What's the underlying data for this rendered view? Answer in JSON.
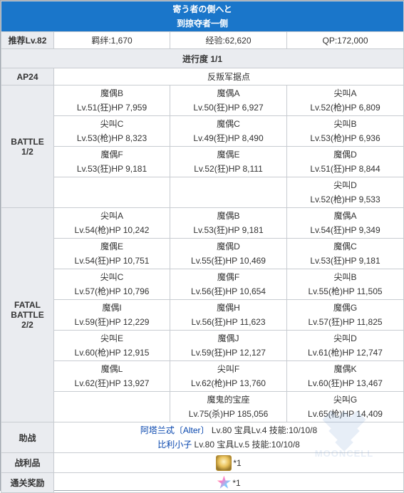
{
  "header": {
    "title_line1": "寄う者の側へと",
    "title_line2": "到掠夺者一侧"
  },
  "summary": {
    "recommend_label": "推荐Lv.82",
    "bond": "羁绊:1,670",
    "exp": "经验:62,620",
    "qp": "QP:172,000"
  },
  "progress": "进行度 1/1",
  "ap": {
    "label": "AP24",
    "location": "反叛军据点"
  },
  "battle1": {
    "label_line1": "BATTLE",
    "label_line2": "1/2",
    "rows": [
      [
        {
          "name": "魔偶B",
          "stat": "Lv.51(狂)HP 7,959"
        },
        {
          "name": "魔偶A",
          "stat": "Lv.50(狂)HP 6,927"
        },
        {
          "name": "尖叫A",
          "stat": "Lv.52(枪)HP 6,809"
        }
      ],
      [
        {
          "name": "尖叫C",
          "stat": "Lv.53(枪)HP 8,323"
        },
        {
          "name": "魔偶C",
          "stat": "Lv.49(狂)HP 8,490"
        },
        {
          "name": "尖叫B",
          "stat": "Lv.53(枪)HP 6,936"
        }
      ],
      [
        {
          "name": "魔偶F",
          "stat": "Lv.53(狂)HP 9,181"
        },
        {
          "name": "魔偶E",
          "stat": "Lv.52(狂)HP 8,111"
        },
        {
          "name": "魔偶D",
          "stat": "Lv.51(狂)HP 8,844"
        }
      ],
      [
        {
          "name": "",
          "stat": ""
        },
        {
          "name": "",
          "stat": ""
        },
        {
          "name": "尖叫D",
          "stat": "Lv.52(枪)HP 9,533"
        }
      ]
    ]
  },
  "battle2": {
    "label_line1": "FATAL",
    "label_line2": "BATTLE",
    "label_line3": "2/2",
    "rows": [
      [
        {
          "name": "尖叫A",
          "stat": "Lv.54(枪)HP 10,242"
        },
        {
          "name": "魔偶B",
          "stat": "Lv.53(狂)HP 9,181"
        },
        {
          "name": "魔偶A",
          "stat": "Lv.54(狂)HP 9,349"
        }
      ],
      [
        {
          "name": "魔偶E",
          "stat": "Lv.54(狂)HP 10,751"
        },
        {
          "name": "魔偶D",
          "stat": "Lv.55(狂)HP 10,469"
        },
        {
          "name": "魔偶C",
          "stat": "Lv.53(狂)HP 9,181"
        }
      ],
      [
        {
          "name": "尖叫C",
          "stat": "Lv.57(枪)HP 10,796"
        },
        {
          "name": "魔偶F",
          "stat": "Lv.56(狂)HP 10,654"
        },
        {
          "name": "尖叫B",
          "stat": "Lv.55(枪)HP 11,505"
        }
      ],
      [
        {
          "name": "魔偶I",
          "stat": "Lv.59(狂)HP 12,229"
        },
        {
          "name": "魔偶H",
          "stat": "Lv.56(狂)HP 11,623"
        },
        {
          "name": "魔偶G",
          "stat": "Lv.57(狂)HP 11,825"
        }
      ],
      [
        {
          "name": "尖叫E",
          "stat": "Lv.60(枪)HP 12,915"
        },
        {
          "name": "魔偶J",
          "stat": "Lv.59(狂)HP 12,127"
        },
        {
          "name": "尖叫D",
          "stat": "Lv.61(枪)HP 12,747"
        }
      ],
      [
        {
          "name": "魔偶L",
          "stat": "Lv.62(狂)HP 13,927"
        },
        {
          "name": "尖叫F",
          "stat": "Lv.62(枪)HP 13,760"
        },
        {
          "name": "魔偶K",
          "stat": "Lv.60(狂)HP 13,467"
        }
      ],
      [
        {
          "name": "",
          "stat": ""
        },
        {
          "name": "魔鬼的宝座",
          "stat": "Lv.75(杀)HP 185,056"
        },
        {
          "name": "尖叫G",
          "stat": "Lv.65(枪)HP 14,409"
        }
      ]
    ]
  },
  "support": {
    "label": "助战",
    "entry1_name": "阿塔兰忒〔Alter〕",
    "entry1_detail": " Lv.80 宝具Lv.4 技能:10/10/8",
    "entry2_name": "比利小子",
    "entry2_detail": " Lv.80 宝具Lv.5 技能:10/10/8"
  },
  "drops": {
    "label": "战利品",
    "qty": "*1",
    "icon": "gold-item-icon"
  },
  "clear_reward": {
    "label": "通关奖励",
    "qty": "*1",
    "icon": "saint-quartz-icon"
  },
  "watermark": "MOONCELL",
  "colors": {
    "header_bg": "#1a76ca",
    "label_bg": "#eaecf0",
    "link": "#0645ad",
    "border": "#c8ccd1"
  }
}
